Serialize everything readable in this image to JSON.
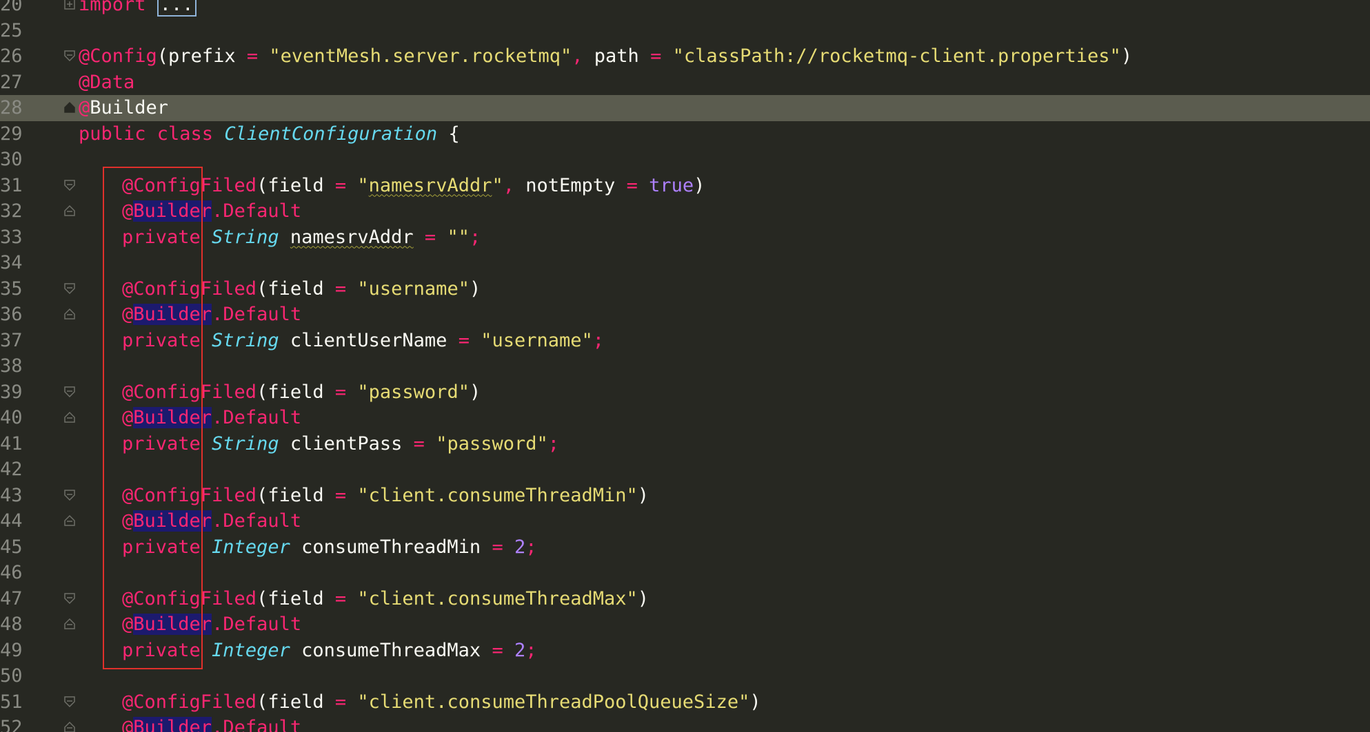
{
  "colors": {
    "background": "#272822",
    "current_line": "#5b5c4f",
    "annotation": "#f92672",
    "keyword": "#f92672",
    "string": "#e6db74",
    "type": "#66d9ef",
    "number": "#ae81ff",
    "highlight_box": "#e0302b"
  },
  "lines": [
    {
      "num": "20",
      "tokens": [
        {
          "t": "kw",
          "v": "import "
        },
        {
          "t": "box",
          "v": "..."
        }
      ]
    },
    {
      "num": "25",
      "tokens": []
    },
    {
      "num": "26",
      "tokens": [
        {
          "t": "ann",
          "v": "@Config"
        },
        {
          "t": "plain",
          "v": "(prefix "
        },
        {
          "t": "op",
          "v": "="
        },
        {
          "t": "str",
          "v": " \"eventMesh.server.rocketmq\""
        },
        {
          "t": "op",
          "v": ","
        },
        {
          "t": "plain",
          "v": " path "
        },
        {
          "t": "op",
          "v": "="
        },
        {
          "t": "str",
          "v": " \"classPath://rocketmq-client.properties\""
        },
        {
          "t": "plain",
          "v": ")"
        }
      ]
    },
    {
      "num": "27",
      "tokens": [
        {
          "t": "ann",
          "v": "@Data"
        }
      ]
    },
    {
      "num": "28",
      "current": true,
      "tokens": [
        {
          "t": "ann",
          "v": "@"
        },
        {
          "t": "plain",
          "v": "Builder"
        }
      ]
    },
    {
      "num": "29",
      "tokens": [
        {
          "t": "kw",
          "v": "public class "
        },
        {
          "t": "type",
          "v": "ClientConfiguration"
        },
        {
          "t": "plain",
          "v": " {"
        }
      ]
    },
    {
      "num": "30",
      "tokens": []
    },
    {
      "num": "31",
      "indent": true,
      "tokens": [
        {
          "t": "ann",
          "v": "@ConfigFiled"
        },
        {
          "t": "plain",
          "v": "(field "
        },
        {
          "t": "op",
          "v": "="
        },
        {
          "t": "str",
          "v": " \""
        },
        {
          "t": "strsq",
          "v": "namesrvAddr"
        },
        {
          "t": "str",
          "v": "\""
        },
        {
          "t": "op",
          "v": ","
        },
        {
          "t": "plain",
          "v": " notEmpty "
        },
        {
          "t": "op",
          "v": "="
        },
        {
          "t": "bool",
          "v": " true"
        },
        {
          "t": "plain",
          "v": ")"
        }
      ]
    },
    {
      "num": "32",
      "indent": true,
      "tokens": [
        {
          "t": "ann",
          "v": "@"
        },
        {
          "t": "annhl",
          "v": "Builder"
        },
        {
          "t": "ann",
          "v": ".Default"
        }
      ]
    },
    {
      "num": "33",
      "indent": true,
      "tokens": [
        {
          "t": "kw",
          "v": "private "
        },
        {
          "t": "type",
          "v": "String"
        },
        {
          "t": "plain",
          "v": " "
        },
        {
          "t": "plainsq",
          "v": "namesrvAddr"
        },
        {
          "t": "op",
          "v": " ="
        },
        {
          "t": "str",
          "v": " \"\""
        },
        {
          "t": "op",
          "v": ";"
        }
      ]
    },
    {
      "num": "34",
      "tokens": []
    },
    {
      "num": "35",
      "indent": true,
      "tokens": [
        {
          "t": "ann",
          "v": "@ConfigFiled"
        },
        {
          "t": "plain",
          "v": "(field "
        },
        {
          "t": "op",
          "v": "="
        },
        {
          "t": "str",
          "v": " \"username\""
        },
        {
          "t": "plain",
          "v": ")"
        }
      ]
    },
    {
      "num": "36",
      "indent": true,
      "tokens": [
        {
          "t": "ann",
          "v": "@"
        },
        {
          "t": "annhl",
          "v": "Builder"
        },
        {
          "t": "ann",
          "v": ".Default"
        }
      ]
    },
    {
      "num": "37",
      "indent": true,
      "tokens": [
        {
          "t": "kw",
          "v": "private "
        },
        {
          "t": "type",
          "v": "String"
        },
        {
          "t": "plain",
          "v": " clientUserName "
        },
        {
          "t": "op",
          "v": "="
        },
        {
          "t": "str",
          "v": " \"username\""
        },
        {
          "t": "op",
          "v": ";"
        }
      ]
    },
    {
      "num": "38",
      "tokens": []
    },
    {
      "num": "39",
      "indent": true,
      "tokens": [
        {
          "t": "ann",
          "v": "@ConfigFiled"
        },
        {
          "t": "plain",
          "v": "(field "
        },
        {
          "t": "op",
          "v": "="
        },
        {
          "t": "str",
          "v": " \"password\""
        },
        {
          "t": "plain",
          "v": ")"
        }
      ]
    },
    {
      "num": "40",
      "indent": true,
      "tokens": [
        {
          "t": "ann",
          "v": "@"
        },
        {
          "t": "annhl",
          "v": "Builder"
        },
        {
          "t": "ann",
          "v": ".Default"
        }
      ]
    },
    {
      "num": "41",
      "indent": true,
      "tokens": [
        {
          "t": "kw",
          "v": "private "
        },
        {
          "t": "type",
          "v": "String"
        },
        {
          "t": "plain",
          "v": " clientPass "
        },
        {
          "t": "op",
          "v": "="
        },
        {
          "t": "str",
          "v": " \"password\""
        },
        {
          "t": "op",
          "v": ";"
        }
      ]
    },
    {
      "num": "42",
      "tokens": []
    },
    {
      "num": "43",
      "indent": true,
      "tokens": [
        {
          "t": "ann",
          "v": "@ConfigFiled"
        },
        {
          "t": "plain",
          "v": "(field "
        },
        {
          "t": "op",
          "v": "="
        },
        {
          "t": "str",
          "v": " \"client.consumeThreadMin\""
        },
        {
          "t": "plain",
          "v": ")"
        }
      ]
    },
    {
      "num": "44",
      "indent": true,
      "tokens": [
        {
          "t": "ann",
          "v": "@"
        },
        {
          "t": "annhl",
          "v": "Builder"
        },
        {
          "t": "ann",
          "v": ".Default"
        }
      ]
    },
    {
      "num": "45",
      "indent": true,
      "tokens": [
        {
          "t": "kw",
          "v": "private "
        },
        {
          "t": "type",
          "v": "Integer"
        },
        {
          "t": "plain",
          "v": " consumeThreadMin "
        },
        {
          "t": "op",
          "v": "="
        },
        {
          "t": "num",
          "v": " 2"
        },
        {
          "t": "op",
          "v": ";"
        }
      ]
    },
    {
      "num": "46",
      "tokens": []
    },
    {
      "num": "47",
      "indent": true,
      "tokens": [
        {
          "t": "ann",
          "v": "@ConfigFiled"
        },
        {
          "t": "plain",
          "v": "(field "
        },
        {
          "t": "op",
          "v": "="
        },
        {
          "t": "str",
          "v": " \"client.consumeThreadMax\""
        },
        {
          "t": "plain",
          "v": ")"
        }
      ]
    },
    {
      "num": "48",
      "indent": true,
      "tokens": [
        {
          "t": "ann",
          "v": "@"
        },
        {
          "t": "annhl",
          "v": "Builder"
        },
        {
          "t": "ann",
          "v": ".Default"
        }
      ]
    },
    {
      "num": "49",
      "indent": true,
      "tokens": [
        {
          "t": "kw",
          "v": "private "
        },
        {
          "t": "type",
          "v": "Integer"
        },
        {
          "t": "plain",
          "v": " consumeThreadMax "
        },
        {
          "t": "op",
          "v": "="
        },
        {
          "t": "num",
          "v": " 2"
        },
        {
          "t": "op",
          "v": ";"
        }
      ]
    },
    {
      "num": "50",
      "tokens": []
    },
    {
      "num": "51",
      "indent": true,
      "tokens": [
        {
          "t": "ann",
          "v": "@ConfigFiled"
        },
        {
          "t": "plain",
          "v": "(field "
        },
        {
          "t": "op",
          "v": "="
        },
        {
          "t": "str",
          "v": " \"client.consumeThreadPoolQueueSize\""
        },
        {
          "t": "plain",
          "v": ")"
        }
      ]
    },
    {
      "num": "52",
      "indent": true,
      "tokens": [
        {
          "t": "ann",
          "v": "@"
        },
        {
          "t": "annhl",
          "v": "Builder"
        },
        {
          "t": "ann",
          "v": ".Default"
        }
      ]
    }
  ],
  "fold_markers": {
    "26": "fold-open-icon",
    "28": "fold-end-icon",
    "31": "fold-open-icon",
    "32": "fold-end-icon",
    "35": "fold-open-icon",
    "36": "fold-end-icon",
    "39": "fold-open-icon",
    "40": "fold-end-icon",
    "43": "fold-open-icon",
    "44": "fold-end-icon",
    "47": "fold-open-icon",
    "48": "fold-end-icon",
    "51": "fold-open-icon",
    "52": "fold-end-icon",
    "20": "fold-plus-icon"
  }
}
